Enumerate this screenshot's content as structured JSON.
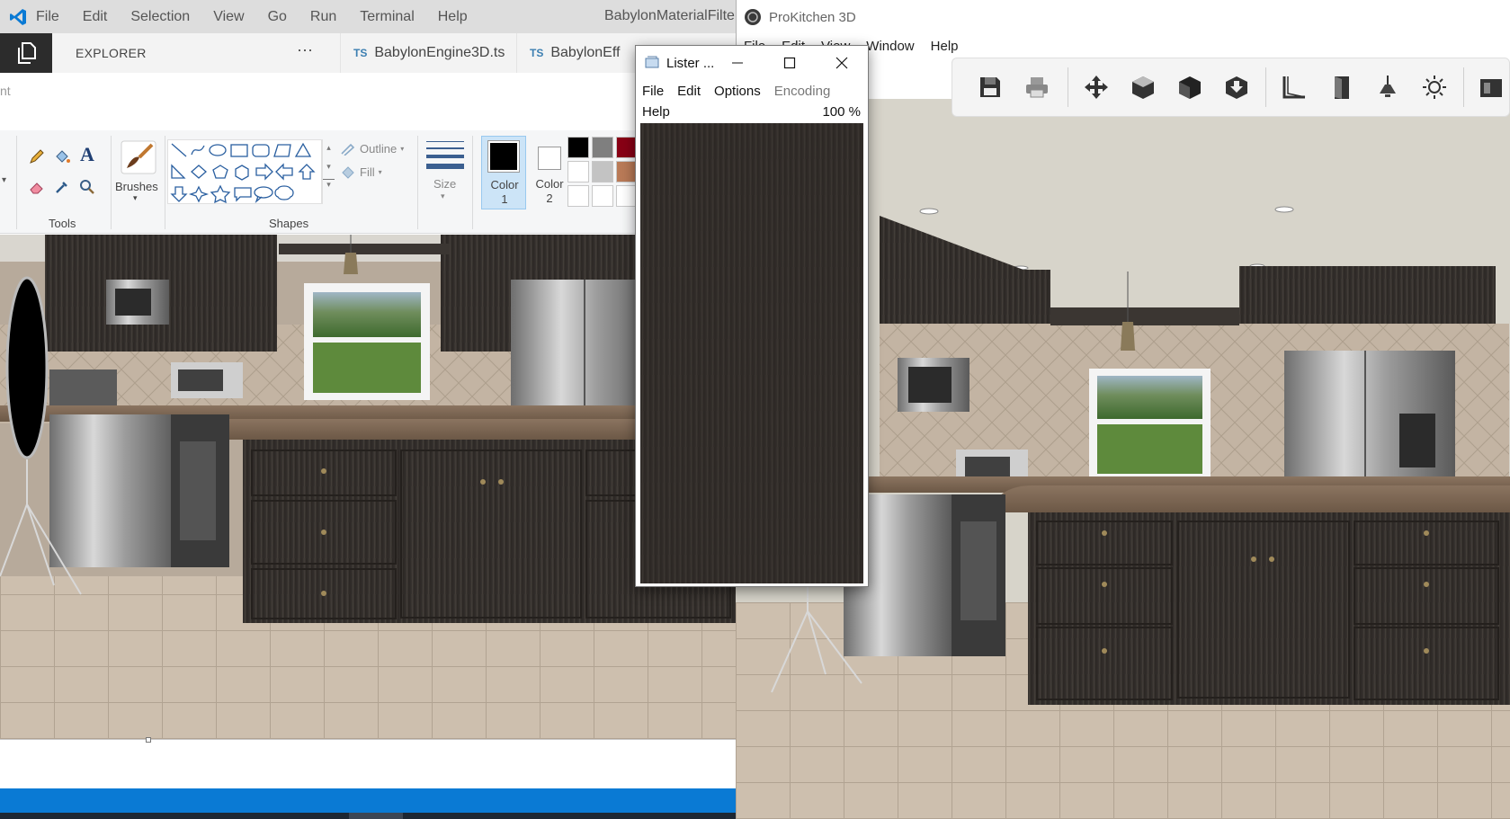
{
  "vscode": {
    "menu": [
      "File",
      "Edit",
      "Selection",
      "View",
      "Go",
      "Run",
      "Terminal",
      "Help"
    ],
    "title": "BabylonMaterialFilter...",
    "explorer_label": "EXPLORER",
    "more_label": "···",
    "tabs": [
      {
        "badge": "TS",
        "label": "BabylonEngine3D.ts"
      },
      {
        "badge": "TS",
        "label": "BabylonEff"
      }
    ],
    "accent": "#0a7ad4"
  },
  "paint": {
    "bar_text": "nt",
    "tools_label": "Tools",
    "brushes_label": "Brushes",
    "shapes_label": "Shapes",
    "outline_label": "Outline",
    "fill_label": "Fill",
    "size_label": "Size",
    "color1_label": "Color",
    "color1_num": "1",
    "color2_label": "Color",
    "color2_num": "2",
    "palette": [
      "#000000",
      "#7f7f7f",
      "#880015",
      "#ffffff",
      "#c3c3c3",
      "#b97a57",
      "#ffffff",
      "#ffffff",
      "#ffffff"
    ]
  },
  "lister": {
    "title": "Lister ...",
    "menu": [
      "File",
      "Edit",
      "Options",
      "Encoding"
    ],
    "help": "Help",
    "zoom": "100 %"
  },
  "prokitchen": {
    "title": "ProKitchen 3D",
    "menu": [
      "File",
      "Edit",
      "View",
      "Window",
      "Help"
    ],
    "toolbar_icons": [
      "save-icon",
      "print-icon",
      "move-icon",
      "box-open-icon",
      "box-solid-icon",
      "box-down-icon",
      "wall-icon",
      "door-icon",
      "lamp-icon",
      "sun-icon",
      "cabinet-icon"
    ]
  }
}
